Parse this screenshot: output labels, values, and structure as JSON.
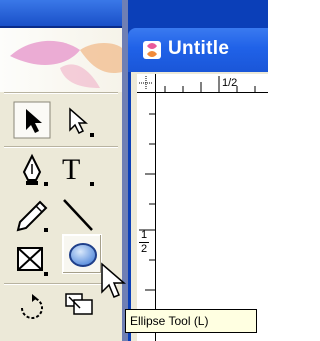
{
  "toolbox": {
    "tools": [
      {
        "name": "selection-tool",
        "icon": "black-arrow-icon"
      },
      {
        "name": "direct-selection-tool",
        "icon": "white-arrow-icon"
      },
      {
        "name": "pen-tool",
        "icon": "pen-nib-icon"
      },
      {
        "name": "type-tool",
        "label": "T",
        "icon": "type-icon"
      },
      {
        "name": "pencil-tool",
        "icon": "pencil-icon"
      },
      {
        "name": "line-tool",
        "icon": "line-icon"
      },
      {
        "name": "rectangle-frame-tool",
        "icon": "rect-frame-x-icon"
      },
      {
        "name": "ellipse-tool",
        "icon": "ellipse-icon",
        "selected": true
      },
      {
        "name": "rotate-tool",
        "icon": "rotate-icon"
      },
      {
        "name": "scale-tool",
        "icon": "scale-icon"
      }
    ]
  },
  "tooltip": {
    "text": "Ellipse Tool (L)"
  },
  "document": {
    "title": "Untitle",
    "ruler_top_label": "1/2",
    "ruler_left_label_num": "1",
    "ruler_left_label_den": "2"
  },
  "colors": {
    "title_bar": "#1a56d8",
    "toolbox_bg": "#ece9d8",
    "tooltip_bg": "#ffffe1",
    "ellipse_fill": "#6f9fe0"
  }
}
